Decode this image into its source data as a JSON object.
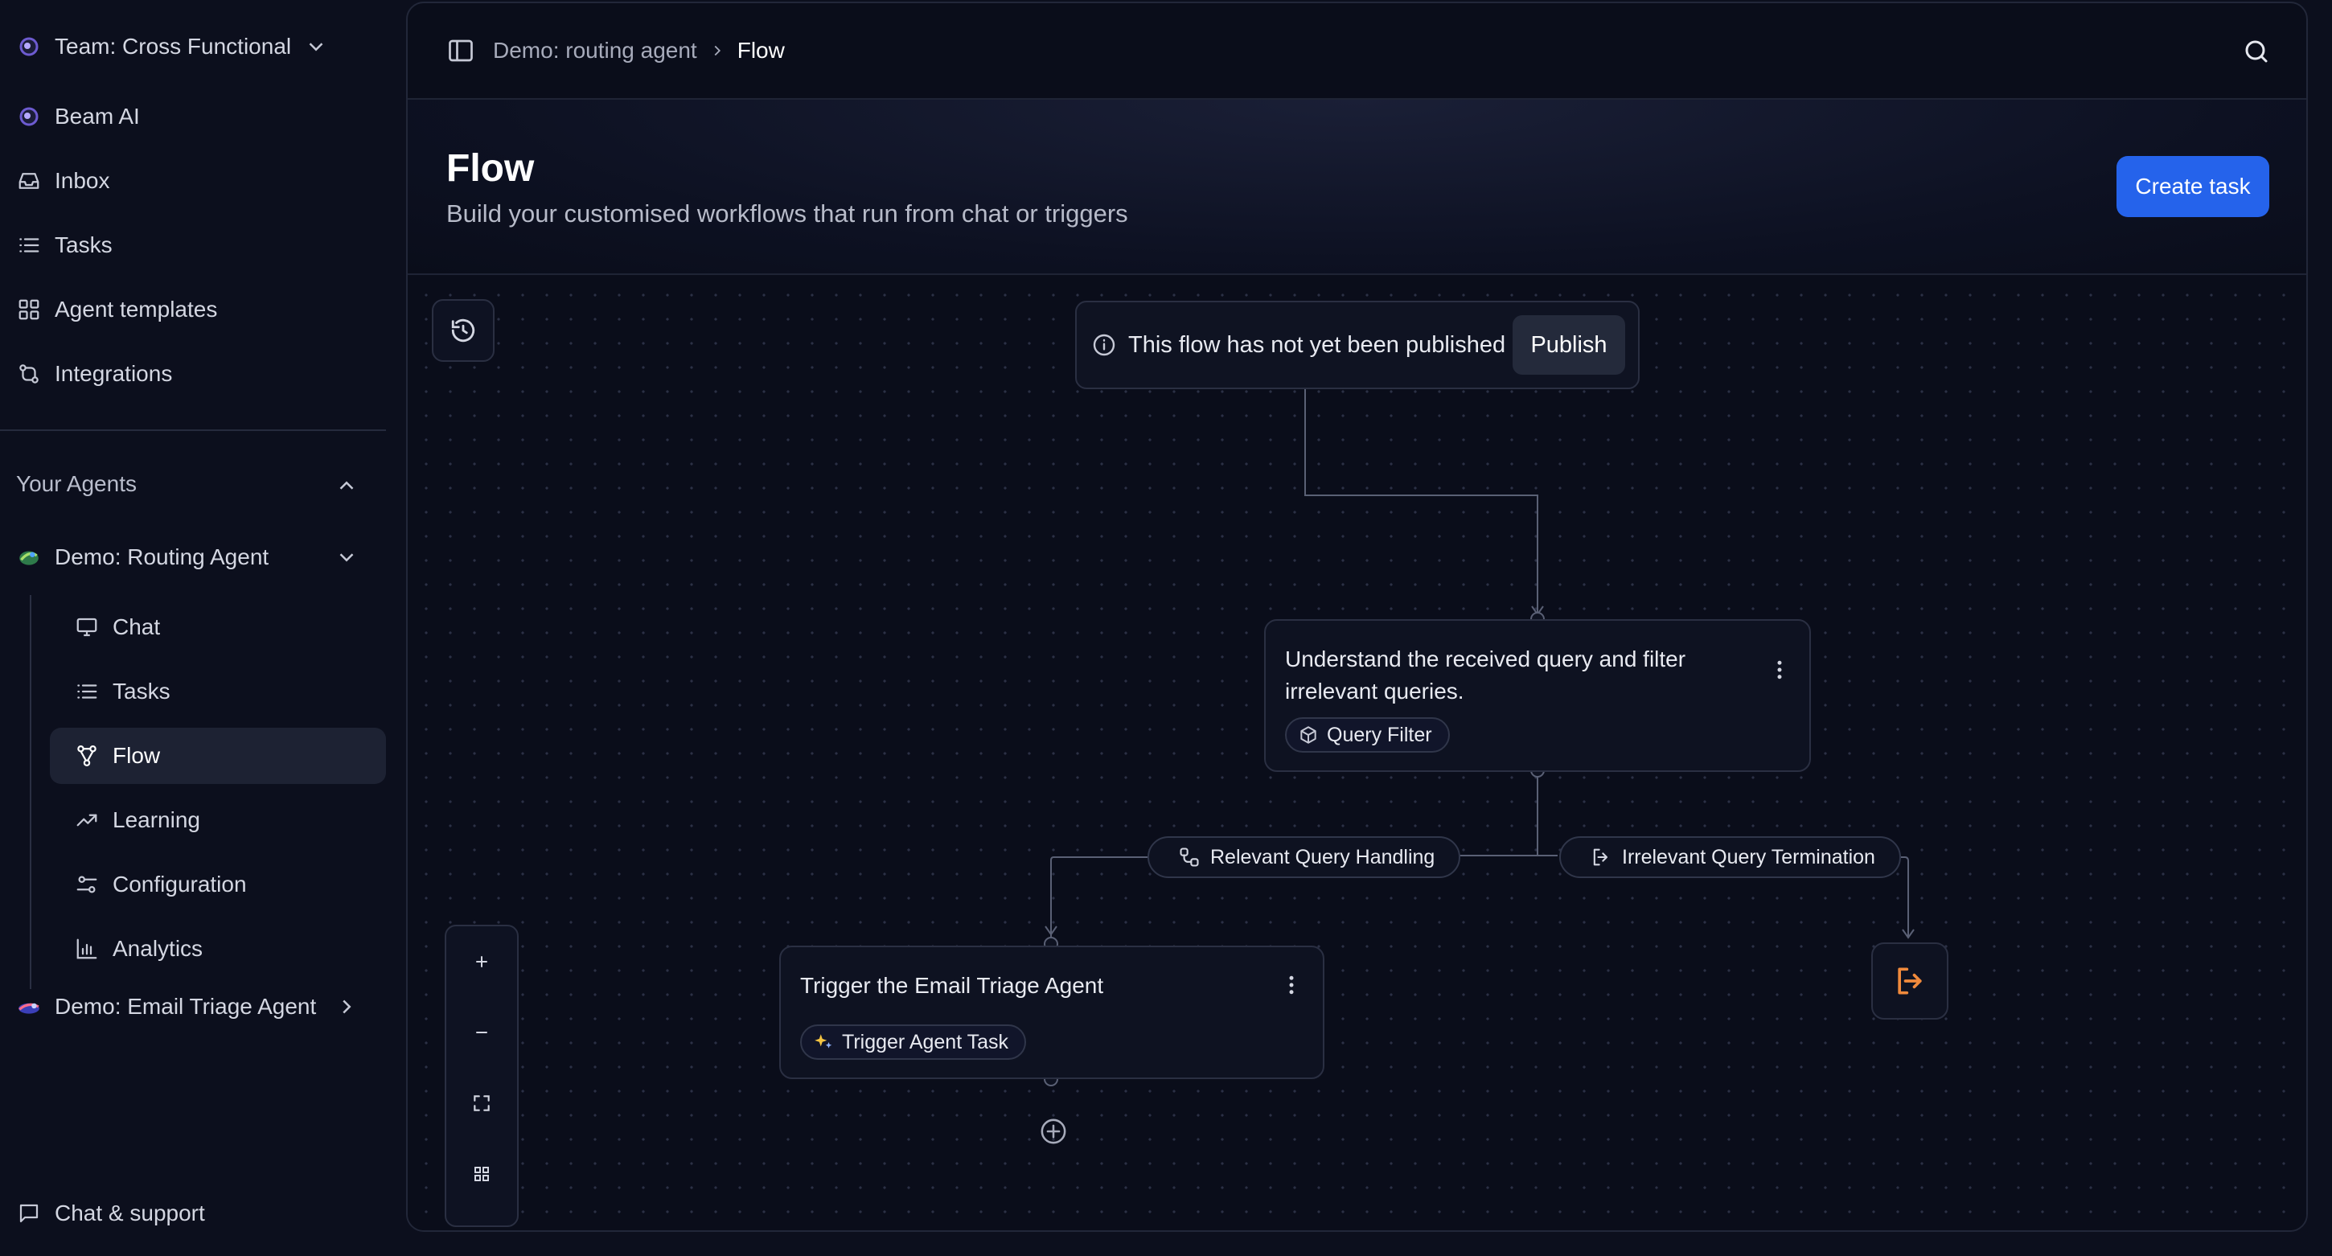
{
  "sidebar": {
    "team": "Team: Cross Functional",
    "nav": [
      {
        "label": "Beam AI",
        "icon": "beam-logo-icon"
      },
      {
        "label": "Inbox",
        "icon": "inbox-icon"
      },
      {
        "label": "Tasks",
        "icon": "list-icon"
      },
      {
        "label": "Agent templates",
        "icon": "grid-icon"
      },
      {
        "label": "Integrations",
        "icon": "integrations-icon"
      }
    ],
    "agents_section": "Your Agents",
    "agent_routing": "Demo: Routing Agent",
    "agent_sub": [
      {
        "label": "Chat",
        "icon": "monitor-icon"
      },
      {
        "label": "Tasks",
        "icon": "list-icon"
      },
      {
        "label": "Flow",
        "icon": "flow-icon",
        "active": true
      },
      {
        "label": "Learning",
        "icon": "trend-icon"
      },
      {
        "label": "Configuration",
        "icon": "sliders-icon"
      },
      {
        "label": "Analytics",
        "icon": "bar-chart-icon"
      }
    ],
    "agent_email": "Demo: Email Triage Agent",
    "support": "Chat & support"
  },
  "breadcrumb": {
    "parent": "Demo: routing agent",
    "current": "Flow"
  },
  "header": {
    "title": "Flow",
    "subtitle": "Build your customised workflows that run from chat or triggers",
    "create_button": "Create task",
    "accent": "#2563eb"
  },
  "canvas": {
    "banner_text": "This flow has not yet been published",
    "publish_button": "Publish",
    "node_filter": {
      "text_line1": "Understand the received query and filter",
      "text_line2": "irrelevant queries.",
      "tag": "Query Filter"
    },
    "edge_relevant": "Relevant Query Handling",
    "edge_irrelevant": "Irrelevant Query Termination",
    "node_trigger": {
      "text": "Trigger the Email Triage Agent",
      "tag": "Trigger Agent Task"
    },
    "end_node_color": "#f08a3c"
  }
}
